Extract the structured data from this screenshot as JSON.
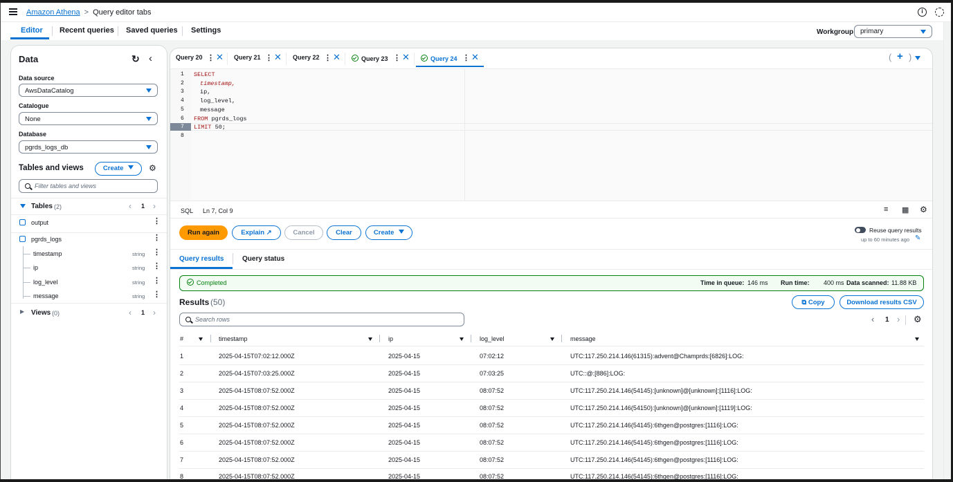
{
  "breadcrumb": {
    "root": "Amazon Athena",
    "current": "Query editor tabs"
  },
  "top_icons": [
    "info-icon",
    "settings-icon"
  ],
  "main_tabs": [
    {
      "label": "Editor"
    },
    {
      "label": "Recent queries"
    },
    {
      "label": "Saved queries"
    },
    {
      "label": "Settings"
    }
  ],
  "workgroup": {
    "label": "Workgroup",
    "value": "primary"
  },
  "data_panel": {
    "title": "Data",
    "data_source": {
      "label": "Data source",
      "value": "AwsDataCatalog"
    },
    "catalogue": {
      "label": "Catalogue",
      "value": "None"
    },
    "database": {
      "label": "Database",
      "value": "pgrds_logs_db"
    },
    "tables_views_title": "Tables and views",
    "create_label": "Create",
    "filter_placeholder": "Filter tables and views",
    "tables": {
      "label": "Tables",
      "count": "(2)",
      "page": "1"
    },
    "items": [
      {
        "name": "output"
      },
      {
        "name": "pgrds_logs"
      }
    ],
    "columns": [
      {
        "name": "timestamp",
        "type": "string"
      },
      {
        "name": "ip",
        "type": "string"
      },
      {
        "name": "log_level",
        "type": "string"
      },
      {
        "name": "message",
        "type": "string"
      }
    ],
    "views": {
      "label": "Views",
      "count": "(0)",
      "page": "1"
    }
  },
  "query_tabs": [
    {
      "label": "Query 20"
    },
    {
      "label": "Query 21"
    },
    {
      "label": "Query 22"
    },
    {
      "label": "Query 23"
    },
    {
      "label": "Query 24"
    }
  ],
  "code_lines": [
    {
      "n": "1",
      "text": "SELECT"
    },
    {
      "n": "2",
      "text": "timestamp,"
    },
    {
      "n": "3",
      "text": "ip,"
    },
    {
      "n": "4",
      "text": "log_level,"
    },
    {
      "n": "5",
      "text": "message"
    },
    {
      "n": "6",
      "kw": "FROM",
      "rest": " pgrds_logs"
    },
    {
      "n": "7",
      "kw": "LIMIT",
      "rest": " 50;"
    },
    {
      "n": "8",
      "text": ""
    }
  ],
  "editor_status": {
    "lang": "SQL",
    "pos": "Ln 7, Col 9"
  },
  "actions": {
    "run": "Run again",
    "explain": "Explain",
    "cancel": "Cancel",
    "clear": "Clear",
    "create": "Create"
  },
  "reuse": {
    "label": "Reuse query results",
    "sub": "up to 60 minutes ago"
  },
  "result_tabs": [
    {
      "label": "Query results"
    },
    {
      "label": "Query status"
    }
  ],
  "status": {
    "text": "Completed",
    "queue_label": "Time in queue:",
    "queue_value": "146 ms",
    "run_label": "Run time:",
    "run_value": "400 ms",
    "scan_label": "Data scanned:",
    "scan_value": "11.88 KB"
  },
  "results": {
    "title": "Results",
    "count": "(50)",
    "copy": "Copy",
    "download": "Download results CSV",
    "search_placeholder": "Search rows",
    "page": "1",
    "headers": [
      "#",
      "timestamp",
      "ip",
      "log_level",
      "message"
    ],
    "rows": [
      [
        "1",
        "2025-04-15T07:02:12.000Z",
        "2025-04-15",
        "07:02:12",
        "UTC:117.250.214.146(61315):advent@Champrds:[6826]:LOG:"
      ],
      [
        "2",
        "2025-04-15T07:03:25.000Z",
        "2025-04-15",
        "07:03:25",
        "UTC::@:[886]:LOG:"
      ],
      [
        "3",
        "2025-04-15T08:07:52.000Z",
        "2025-04-15",
        "08:07:52",
        "UTC:117.250.214.146(54145):[unknown]@[unknown]:[1116]:LOG:"
      ],
      [
        "4",
        "2025-04-15T08:07:52.000Z",
        "2025-04-15",
        "08:07:52",
        "UTC:117.250.214.146(54150):[unknown]@[unknown]:[1119]:LOG:"
      ],
      [
        "5",
        "2025-04-15T08:07:52.000Z",
        "2025-04-15",
        "08:07:52",
        "UTC:117.250.214.146(54145):6thgen@postgres:[1116]:LOG:"
      ],
      [
        "6",
        "2025-04-15T08:07:52.000Z",
        "2025-04-15",
        "08:07:52",
        "UTC:117.250.214.146(54145):6thgen@postgres:[1116]:LOG:"
      ],
      [
        "7",
        "2025-04-15T08:07:52.000Z",
        "2025-04-15",
        "08:07:52",
        "UTC:117.250.214.146(54145):6thgen@postgres:[1116]:LOG:"
      ],
      [
        "8",
        "2025-04-15T08:07:52.000Z",
        "2025-04-15",
        "08:07:52",
        "UTC:117.250.214.146(54145):6thgen@postgres:[1116]:LOG:"
      ]
    ]
  },
  "colors": {
    "accent": "#0972d3",
    "run": "#ff9900",
    "success": "#037f0c"
  }
}
